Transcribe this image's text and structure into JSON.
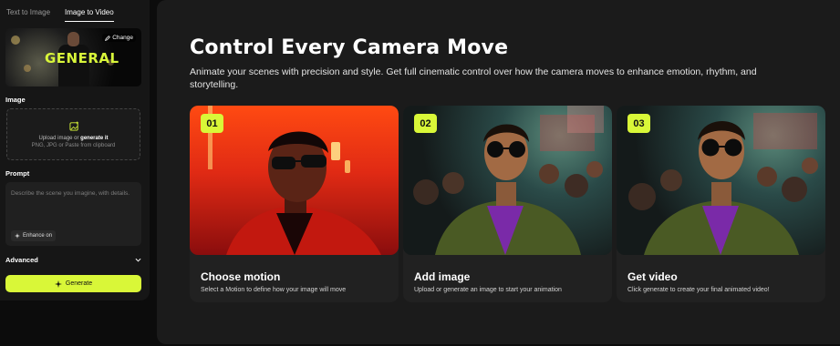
{
  "sidebar": {
    "tabs": [
      {
        "label": "Text to Image",
        "active": false
      },
      {
        "label": "Image to Video",
        "active": true
      }
    ],
    "preview": {
      "overlay_text": "GENERAL",
      "change_label": "Change"
    },
    "image_label": "Image",
    "upload": {
      "line1_prefix": "Upload image or ",
      "line1_link": "generate it",
      "line2": "PNG, JPG or Paste from clipboard"
    },
    "prompt_label": "Prompt",
    "prompt_placeholder": "Describe the scene you imagine, with details.",
    "enhance_label": "Enhance on",
    "advanced_label": "Advanced",
    "generate_label": "Generate"
  },
  "main": {
    "title": "Control Every Camera Move",
    "subtitle": "Animate your scenes with precision and style. Get full cinematic control over how the camera moves to enhance emotion, rhythm, and storytelling.",
    "cards": [
      {
        "num": "01",
        "title": "Choose motion",
        "desc": "Select a Motion to define how your image will move"
      },
      {
        "num": "02",
        "title": "Add image",
        "desc": "Upload or generate an image to start your animation"
      },
      {
        "num": "03",
        "title": "Get video",
        "desc": "Click generate to create your final animated video!"
      }
    ]
  },
  "colors": {
    "accent": "#d9f738",
    "panel": "#1b1b1b",
    "sidebar": "#161616",
    "card": "#212121"
  }
}
